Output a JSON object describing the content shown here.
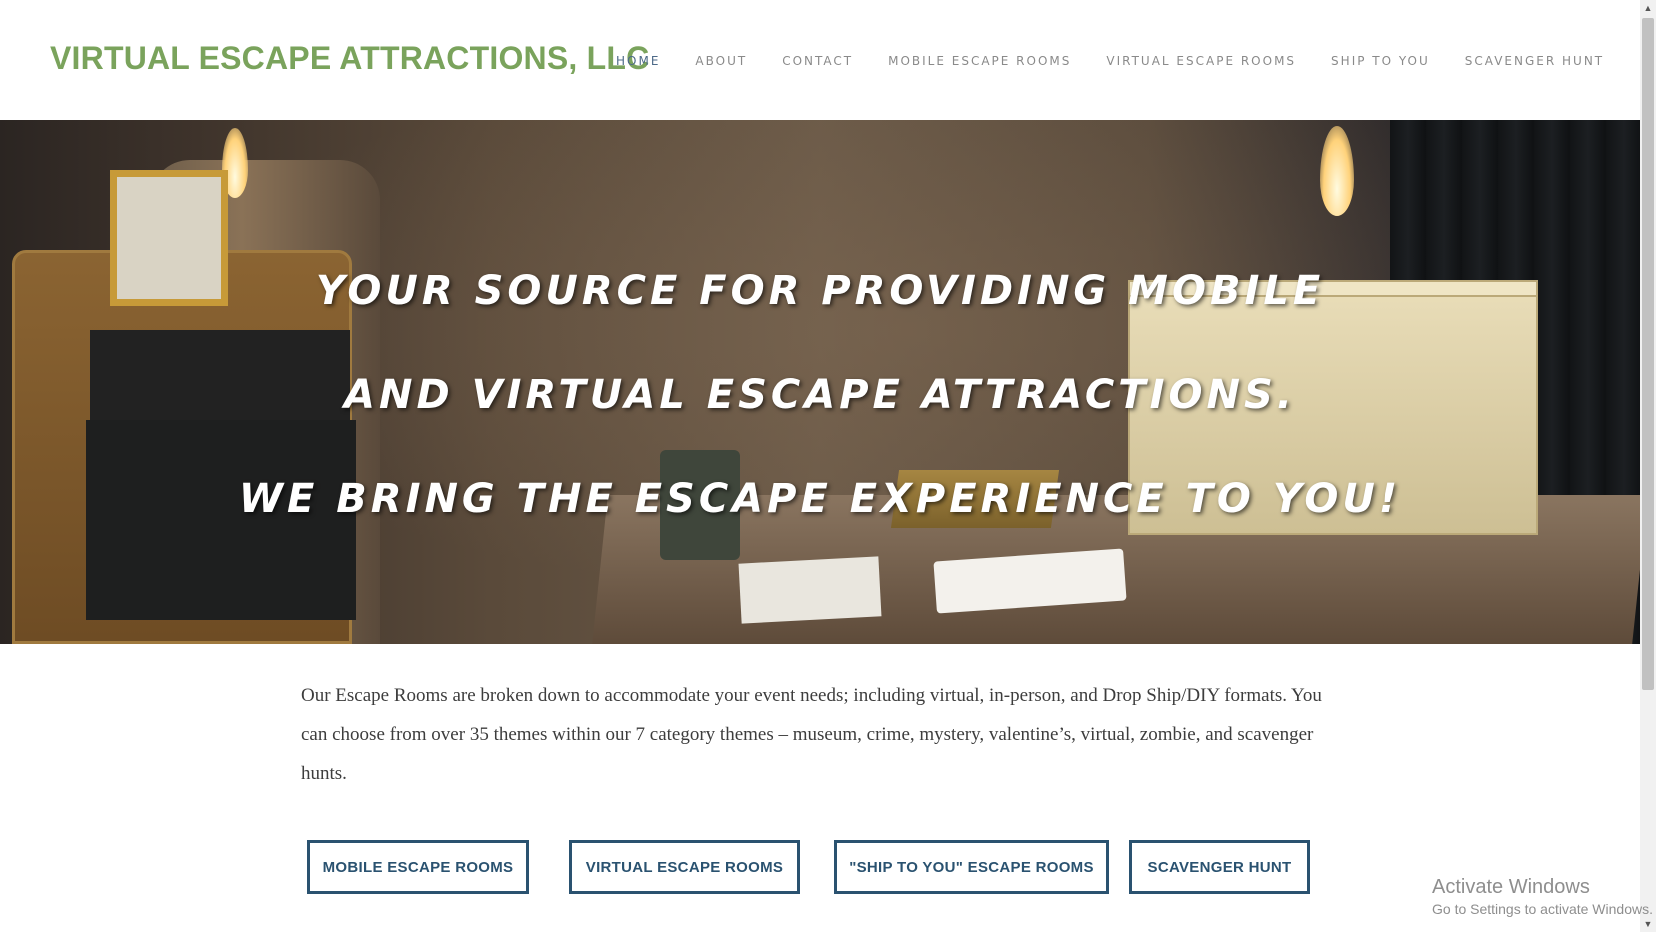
{
  "header": {
    "site_title": "VIRTUAL ESCAPE ATTRACTIONS, LLC",
    "nav": [
      {
        "label": "HOME",
        "active": true
      },
      {
        "label": "ABOUT",
        "active": false
      },
      {
        "label": "CONTACT",
        "active": false
      },
      {
        "label": "MOBILE ESCAPE ROOMS",
        "active": false
      },
      {
        "label": "VIRTUAL ESCAPE ROOMS",
        "active": false
      },
      {
        "label": "SHIP TO YOU",
        "active": false
      },
      {
        "label": "SCAVENGER HUNT",
        "active": false
      }
    ]
  },
  "hero": {
    "line1": "Your source for providing mobile",
    "line2": "and virtual escape attractions.",
    "line3": "We bring the escape experience to you!"
  },
  "intro": {
    "text": "Our Escape Rooms are broken down to accommodate your event needs; including virtual, in-person, and Drop Ship/DIY formats. You can choose from over 35 themes within our 7 category themes – museum, crime, mystery, valentine’s, virtual, zombie, and scavenger hunts."
  },
  "buttons": {
    "mobile": "MOBILE ESCAPE ROOMS",
    "virtual": "VIRTUAL ESCAPE ROOMS",
    "ship": "\"SHIP TO YOU\" ESCAPE ROOMS",
    "scavenger": "SCAVENGER HUNT"
  },
  "watermark": {
    "title": "Activate Windows",
    "subtitle": "Go to Settings to activate Windows."
  },
  "colors": {
    "brand_green": "#7aa35c",
    "nav_active": "#4d6a88",
    "button_border": "#2a5270"
  }
}
